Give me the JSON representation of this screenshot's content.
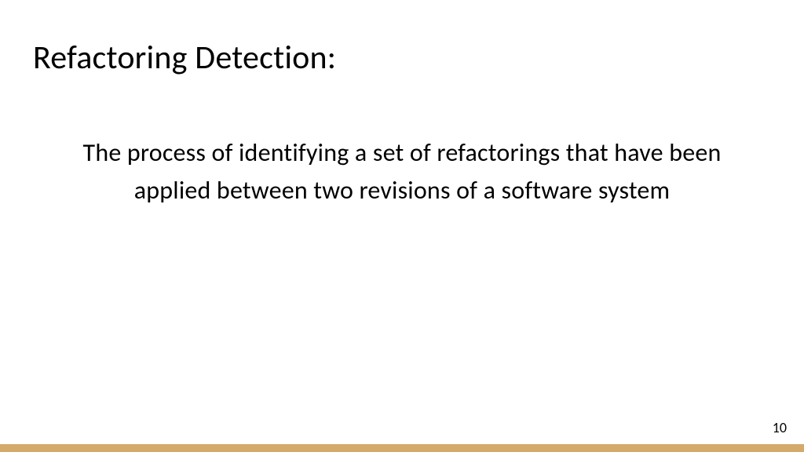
{
  "slide": {
    "title": "Refactoring Detection:",
    "body": "The process of identifying a set of refactorings that have been applied between two revisions of a software system",
    "page_number": "10"
  },
  "colors": {
    "accent_bar": "#d4a96a",
    "text": "#000000",
    "background": "#ffffff"
  }
}
